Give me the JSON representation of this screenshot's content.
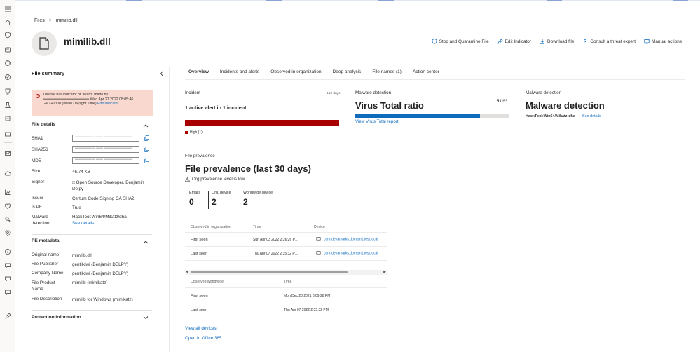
{
  "breadcrumb": {
    "root": "Files",
    "separator": ">",
    "current": "mimilib.dll"
  },
  "file": {
    "name": "mimilib.dll"
  },
  "actions": [
    {
      "label": "Stop and Quarantine File",
      "icon": "shield-icon"
    },
    {
      "label": "Edit Indicator",
      "icon": "edit-icon"
    },
    {
      "label": "Download file",
      "icon": "download-icon"
    },
    {
      "label": "Consult a threat expert",
      "icon": "question-icon"
    },
    {
      "label": "Manual actions",
      "icon": "manual-actions-icon"
    }
  ],
  "summary": {
    "title": "File summary",
    "warning": {
      "text": "This file has indicator of \"Warn\" made by ══════════════════ Wed Apr 27 2022 08:05:46 GMT+0300 (Israel Daylight Time)",
      "link": "Edit Indicator"
    },
    "file_details": {
      "title": "File details",
      "sha1_label": "SHA1",
      "sha1_value": "═══════ ═ ═══ ════════════",
      "sha256_label": "SHA256",
      "sha256_value": "═══════ ═ ═══ ════════════",
      "md5_label": "MD5",
      "md5_value": "═══════ ═ ═══ ════════════",
      "size_label": "Size",
      "size_value": "46.74 KB",
      "signer_label": "Signer",
      "signer_value": "Open Source Developer, Benjamin Delpy",
      "issuer_label": "Issuer",
      "issuer_value": "Certum Code Signing CA SHA2",
      "ispe_label": "Is PE",
      "ispe_value": "True",
      "malware_label": "Malware detection",
      "malware_value": "HackTool:Win64/Mikatz!dha",
      "see_details": "See details"
    },
    "pe_metadata": {
      "title": "PE metadata",
      "original_name_label": "Original name",
      "original_name_value": "mimilib.dll",
      "publisher_label": "File Publisher",
      "publisher_value": "gentilkiwi (Benjamin DELPY)",
      "company_label": "Company Name",
      "company_value": "gentilkiwi (Benjamin DELPY)",
      "product_label": "File Product Name",
      "product_value": "mimilib (mimikatz)",
      "description_label": "File Description",
      "description_value": "mimilib for Windows (mimikatz)"
    },
    "protection": {
      "title": "Protection Information"
    }
  },
  "tabs": [
    {
      "label": "Overview",
      "active": true
    },
    {
      "label": "Incidents and alerts"
    },
    {
      "label": "Observed in organization"
    },
    {
      "label": "Deep analysis"
    },
    {
      "label": "File names  (1)"
    },
    {
      "label": "Action center"
    }
  ],
  "incident": {
    "label": "Incident",
    "range": "180 days",
    "summary": "1 active alert  in 1 incident",
    "severity_color": "#a80000",
    "legend": "High (1)"
  },
  "malware_vt": {
    "label": "Malware detection",
    "title": "Virus Total ratio",
    "positives": "51",
    "total": "/63",
    "fill_fraction": 0.81,
    "bar_color": "#0f6cbd",
    "link": "View Virus Total report"
  },
  "malware_md": {
    "label": "Malware detection",
    "title": "Malware detection",
    "threat_name": "HackTool:Win64/Mikatz!dha",
    "link": "See details"
  },
  "prevalence": {
    "label": "File prevalence",
    "title": "File prevalence (last 30 days)",
    "note": "Org prevalence level is low",
    "stats": [
      {
        "label": "Emails",
        "value": "0"
      },
      {
        "label": "Org. device",
        "value": "2"
      },
      {
        "label": "Worldwide device",
        "value": "2"
      }
    ],
    "org_table": {
      "headers": [
        "Observed in organization",
        "Time",
        "Device"
      ],
      "rows": [
        {
          "label": "First seen",
          "time": "Sun Apr 03 2022 2:26:26 P…",
          "device": "cont-denamarks.domain1.test.local"
        },
        {
          "label": "Last seen",
          "time": "Thu Apr 07 2022 2:35:32 P…",
          "device": "cont-denamarks.domain1.test.local"
        }
      ]
    },
    "world_table": {
      "headers": [
        "Observed worldwide",
        "Time"
      ],
      "rows": [
        {
          "label": "First seen",
          "time": "Mon Dec 20 2021 8:09:28 PM"
        },
        {
          "label": "Last seen",
          "time": "Thu Apr 07 2022 2:35:32 PM"
        }
      ]
    },
    "view_all": "View all devices",
    "open_office": "Open in Office 365"
  }
}
